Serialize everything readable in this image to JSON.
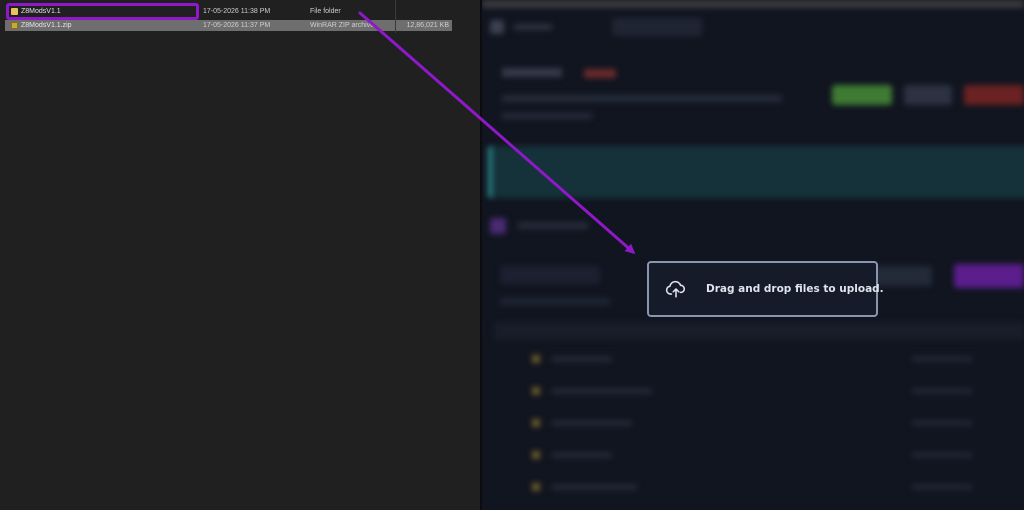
{
  "explorer": {
    "rows": [
      {
        "name": "Z8ModsV1.1",
        "date": "17-05-2026 11:38 PM",
        "type": "File folder",
        "size": ""
      },
      {
        "name": "Z8ModsV1.1.zip",
        "date": "17-05-2026 11:37 PM",
        "type": "WinRAR ZIP archive",
        "size": "12,86,021 KB"
      }
    ]
  },
  "dropzone": {
    "text": "Drag and drop files to upload."
  },
  "colors": {
    "highlight": "#8f18c8",
    "arrow": "#8f18c8",
    "dropzone_border": "#8a96ad"
  },
  "icons": {
    "folder": "folder-icon",
    "zip": "zip-archive-icon",
    "upload": "cloud-upload-icon"
  }
}
